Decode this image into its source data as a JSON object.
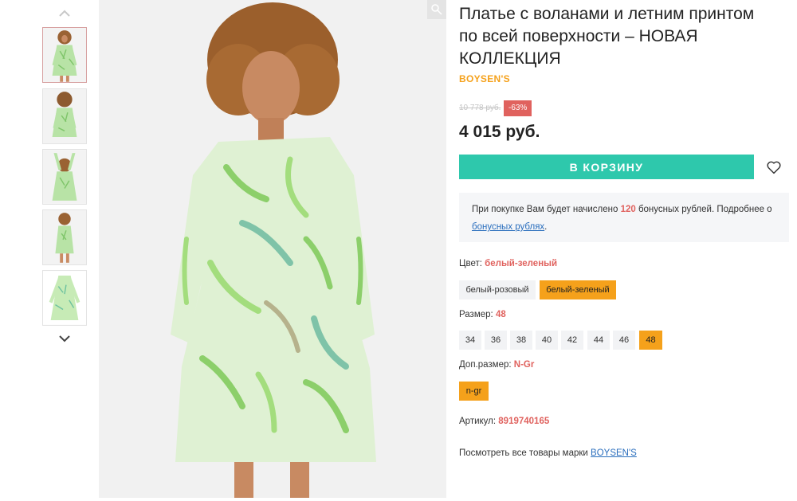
{
  "gallery": {
    "thumbnails": [
      {
        "alt": "thumb-front"
      },
      {
        "alt": "thumb-back"
      },
      {
        "alt": "thumb-arms-up"
      },
      {
        "alt": "thumb-side"
      },
      {
        "alt": "thumb-flat"
      }
    ],
    "up_icon": "chevron-up-icon",
    "down_icon": "chevron-down-icon",
    "zoom_icon": "magnifier-icon"
  },
  "product": {
    "title": "Платье с воланами и летним принтом по всей поверхности – НОВАЯ КОЛЛЕКЦИЯ",
    "brand": "BOYSEN'S",
    "old_price": "10 778 руб.",
    "discount": "-63%",
    "price": "4 015 руб.",
    "cart_button": "В КОРЗИНУ",
    "favorite_icon": "heart-icon"
  },
  "bonus": {
    "text_before": "При покупке Вам будет начислено ",
    "amount": "120",
    "text_after": " бонусных рублей. Подробнее о ",
    "link": "бонусных рублях",
    "end": "."
  },
  "color": {
    "label": "Цвет:",
    "value": "белый-зеленый",
    "options": [
      "белый-розовый",
      "белый-зеленый"
    ],
    "selected": "белый-зеленый"
  },
  "size": {
    "label": "Размер:",
    "value": "48",
    "options": [
      "34",
      "36",
      "38",
      "40",
      "42",
      "44",
      "46",
      "48"
    ],
    "selected": "48"
  },
  "extra_size": {
    "label": "Доп.размер:",
    "value": "N-Gr",
    "options": [
      "n-gr"
    ],
    "selected": "n-gr"
  },
  "article": {
    "label": "Артикул:",
    "value": "8919740165"
  },
  "see_all": {
    "text": "Посмотреть все товары марки ",
    "link": "BOYSEN'S"
  },
  "colors": {
    "accent_teal": "#2ec8ac",
    "brand_orange": "#f5a11b",
    "sale_red": "#e0625e",
    "link_blue": "#2a6ebd"
  }
}
